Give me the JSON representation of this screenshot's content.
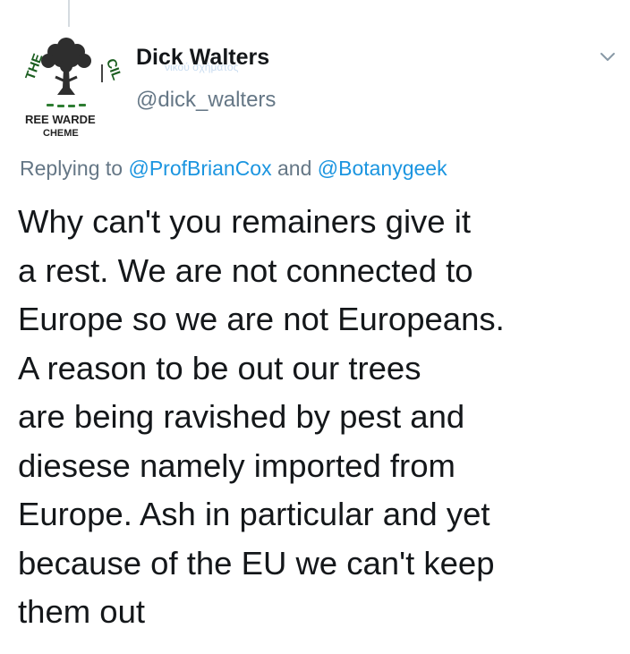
{
  "tweet": {
    "display_name": "Dick Walters",
    "faint_overlay_text": "νικού σχήματος",
    "handle": "@dick_walters",
    "avatar": {
      "icon": "tree-logo-icon",
      "text_top_left": "THE",
      "text_top_right": "CIL",
      "text_bottom_1": "REE WARDE",
      "text_bottom_2": "CHEME"
    },
    "menu_icon": "chevron-down-icon",
    "replying": {
      "prefix": "Replying to ",
      "mention_1": "@ProfBrianCox",
      "joiner": " and ",
      "mention_2": "@Botanygeek"
    },
    "body_lines": [
      "Why can't you remainers give it",
      "a rest. We are not connected to",
      "Europe so we are not Europeans.",
      "A reason to be out our trees",
      "are being ravished by pest and",
      "diesese namely imported from",
      "Europe. Ash in particular and yet",
      "because of the EU we can't keep",
      "them out"
    ]
  },
  "colors": {
    "text": "#14171a",
    "secondary": "#657786",
    "link": "#1b95e0",
    "logo_green": "#2e7d32"
  }
}
